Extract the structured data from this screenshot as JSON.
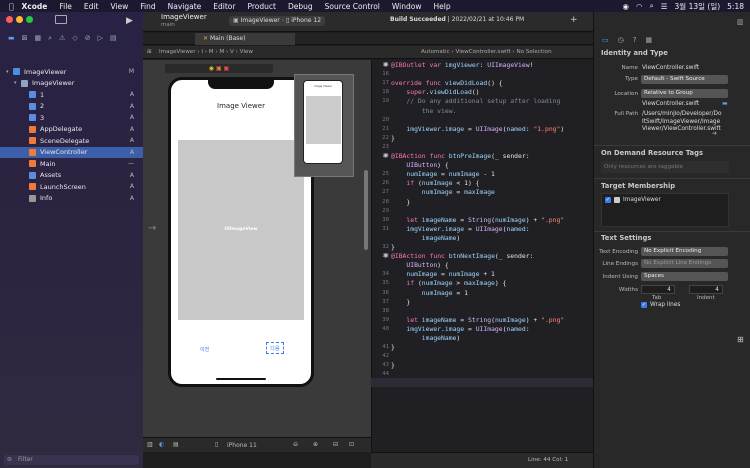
{
  "menubar": {
    "app": "Xcode",
    "items": [
      "File",
      "Edit",
      "View",
      "Find",
      "Navigate",
      "Editor",
      "Product",
      "Debug",
      "Source Control",
      "Window",
      "Help"
    ],
    "date": "3월 13일 (일)",
    "time": "5:18"
  },
  "toolbar": {
    "project": "ImageViewer",
    "branch": "main",
    "scheme": "ImageViewer",
    "device": "iPhone 12",
    "status": "Build Succeeded",
    "status_date": "| 2022/02/21 at 10:46 PM",
    "tab": "Main (Base)",
    "breadcrumb_left": [
      "ImageViewer",
      "I",
      "M",
      "M",
      "V",
      "View"
    ],
    "breadcrumb_right": [
      "Automatic",
      "ViewController.swift",
      "No Selection"
    ]
  },
  "navigator": {
    "items": [
      {
        "label": "ImageViewer",
        "status": "M",
        "indent": 0,
        "color": "#4a8fe0"
      },
      {
        "label": "ImageViewer",
        "status": "",
        "indent": 1,
        "color": "#8fa4c0"
      },
      {
        "label": "1",
        "status": "A",
        "indent": 2,
        "color": "#5b8de0"
      },
      {
        "label": "2",
        "status": "A",
        "indent": 2,
        "color": "#5b8de0"
      },
      {
        "label": "3",
        "status": "A",
        "indent": 2,
        "color": "#5b8de0"
      },
      {
        "label": "AppDelegate",
        "status": "A",
        "indent": 2,
        "color": "#f07a3a"
      },
      {
        "label": "SceneDelegate",
        "status": "A",
        "indent": 2,
        "color": "#f07a3a"
      },
      {
        "label": "ViewController",
        "status": "A",
        "indent": 2,
        "color": "#f07a3a"
      },
      {
        "label": "Main",
        "status": "—",
        "indent": 2,
        "color": "#f07a3a"
      },
      {
        "label": "Assets",
        "status": "A",
        "indent": 2,
        "color": "#5b8de0"
      },
      {
        "label": "LaunchScreen",
        "status": "A",
        "indent": 2,
        "color": "#f07a3a"
      },
      {
        "label": "Info",
        "status": "A",
        "indent": 2,
        "color": "#999"
      }
    ],
    "filter_placeholder": "Filter"
  },
  "storyboard": {
    "title": "Image Viewer",
    "image_label": "UIImageView",
    "prev_label": "이전",
    "next_label": "다음",
    "device_label": "iPhone 11",
    "mini_title": "Image Viewer"
  },
  "editor": {
    "lines": [
      {
        "n": "15",
        "code": "@IBOutlet var imgViewer: UIImageView!"
      },
      {
        "n": "16",
        "code": ""
      },
      {
        "n": "17",
        "code": "override func viewDidLoad() {"
      },
      {
        "n": "18",
        "code": "    super.viewDidLoad()"
      },
      {
        "n": "19",
        "code": "    // Do any additional setup after loading"
      },
      {
        "n": "",
        "code": "        the view."
      },
      {
        "n": "20",
        "code": ""
      },
      {
        "n": "21",
        "code": "    imgViewer.image = UIImage(named: \"1.png\")"
      },
      {
        "n": "22",
        "code": "}"
      },
      {
        "n": "23",
        "code": ""
      },
      {
        "n": "24",
        "code": "@IBAction func btnPreImage(_ sender:"
      },
      {
        "n": "",
        "code": "    UIButton) {"
      },
      {
        "n": "25",
        "code": "    numImage = numImage - 1"
      },
      {
        "n": "26",
        "code": "    if (numImage < 1) {"
      },
      {
        "n": "27",
        "code": "        numImage = maxImage"
      },
      {
        "n": "28",
        "code": "    }"
      },
      {
        "n": "29",
        "code": ""
      },
      {
        "n": "30",
        "code": "    let imageName = String(numImage) + \".png\""
      },
      {
        "n": "31",
        "code": "    imgViewer.image = UIImage(named:"
      },
      {
        "n": "",
        "code": "        imageName)"
      },
      {
        "n": "32",
        "code": "}"
      },
      {
        "n": "33",
        "code": "@IBAction func btnNextImage(_ sender:"
      },
      {
        "n": "",
        "code": "    UIButton) {"
      },
      {
        "n": "34",
        "code": "    numImage = numImage + 1"
      },
      {
        "n": "35",
        "code": "    if (numImage > maxImage) {"
      },
      {
        "n": "36",
        "code": "        numImage = 1"
      },
      {
        "n": "37",
        "code": "    }"
      },
      {
        "n": "38",
        "code": ""
      },
      {
        "n": "39",
        "code": "    let imageName = String(numImage) + \".png\""
      },
      {
        "n": "40",
        "code": "    imgViewer.image = UIImage(named:"
      },
      {
        "n": "",
        "code": "        imageName)"
      },
      {
        "n": "41",
        "code": "}"
      },
      {
        "n": "42",
        "code": ""
      },
      {
        "n": "43",
        "code": "}"
      },
      {
        "n": "44",
        "code": ""
      }
    ],
    "status": "Line: 44  Col: 1"
  },
  "inspector": {
    "identity_title": "Identity and Type",
    "name_label": "Name",
    "name_value": "ViewController.swift",
    "type_label": "Type",
    "type_value": "Default - Swift Source",
    "location_label": "Location",
    "location_value": "Relative to Group",
    "location_file": "ViewController.swift",
    "fullpath_label": "Full Path",
    "fullpath_value": "/Users/minjio/Developer/DoItSwift/ImageViewer/ImageViewer/ViewController.swift",
    "ondemand_title": "On Demand Resource Tags",
    "tags_placeholder": "Only resources are taggable",
    "membership_title": "Target Membership",
    "membership_target": "ImageViewer",
    "text_title": "Text Settings",
    "encoding_label": "Text Encoding",
    "encoding_value": "No Explicit Encoding",
    "endings_label": "Line Endings",
    "endings_value": "No Explicit Line Endings",
    "indent_label": "Indent Using",
    "indent_value": "Spaces",
    "widths_label": "Widths",
    "tab_value": "4",
    "indent_width_value": "4",
    "tab_label": "Tab",
    "indent_label2": "Indent",
    "wrap_label": "Wrap lines"
  }
}
